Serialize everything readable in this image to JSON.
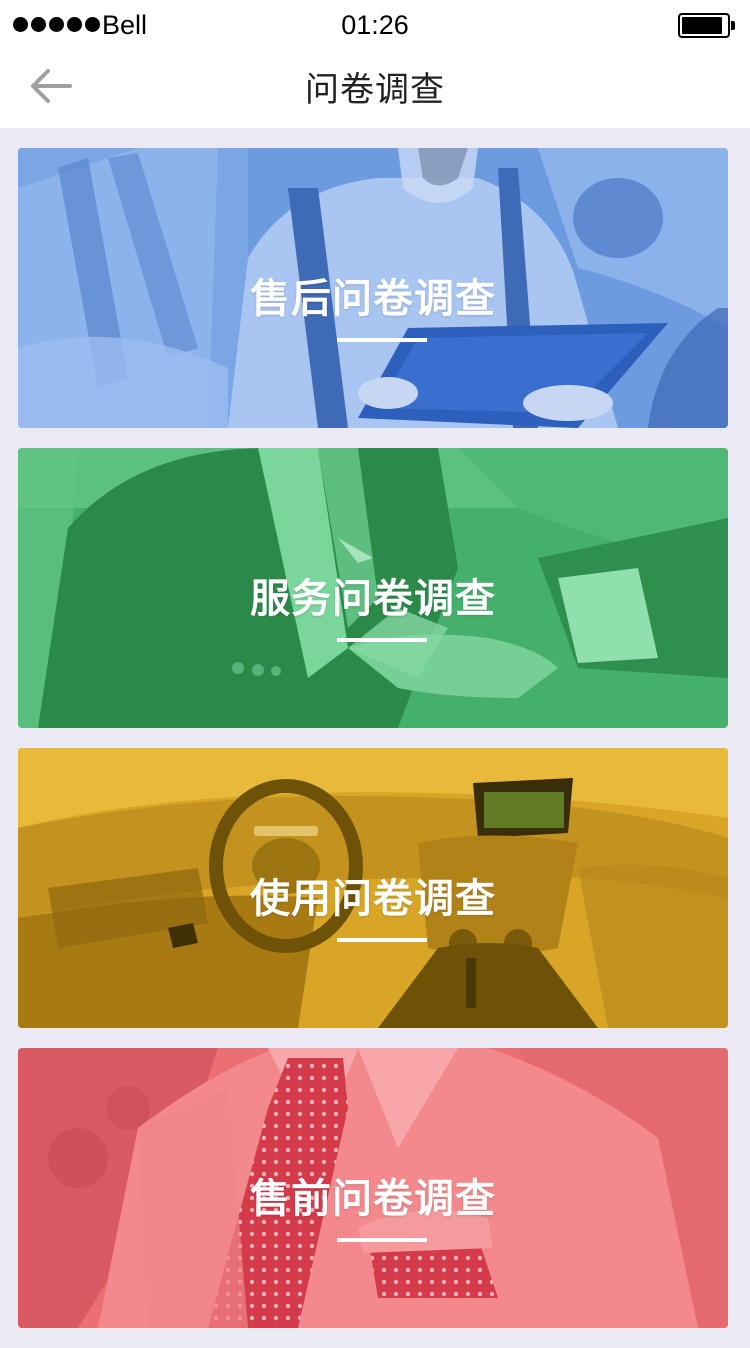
{
  "status_bar": {
    "carrier": "Bell",
    "time": "01:26"
  },
  "nav": {
    "title": "问卷调查",
    "back_icon": "arrow-left-icon"
  },
  "colors": {
    "blue": "#5b8fdb",
    "green": "#3aa863",
    "yellow": "#d9a51f",
    "red": "#f07a7a"
  },
  "cards": [
    {
      "title": "售后问卷调查"
    },
    {
      "title": "服务问卷调查"
    },
    {
      "title": "使用问卷调查"
    },
    {
      "title": "售前问卷调查"
    }
  ]
}
